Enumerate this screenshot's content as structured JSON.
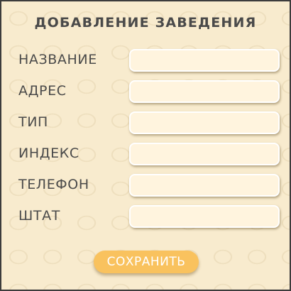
{
  "form": {
    "title": "ДОБАВЛЕНИЕ ЗАВЕДЕНИЯ",
    "fields": [
      {
        "label": "НАЗВАНИЕ",
        "value": "",
        "placeholder": ""
      },
      {
        "label": "АДРЕС",
        "value": "",
        "placeholder": ""
      },
      {
        "label": "ТИП",
        "value": "",
        "placeholder": ""
      },
      {
        "label": "ИНДЕКС",
        "value": "",
        "placeholder": ""
      },
      {
        "label": "ТЕЛЕФОН",
        "value": "",
        "placeholder": ""
      },
      {
        "label": "ШТАТ",
        "value": "",
        "placeholder": ""
      }
    ],
    "save_label": "СОХРАНИТЬ"
  },
  "colors": {
    "background": "#f8ebce",
    "text": "#4a4a4a",
    "input_fill": "#fff4de",
    "button": "#f9c25e",
    "border": "#3c3c3c"
  }
}
